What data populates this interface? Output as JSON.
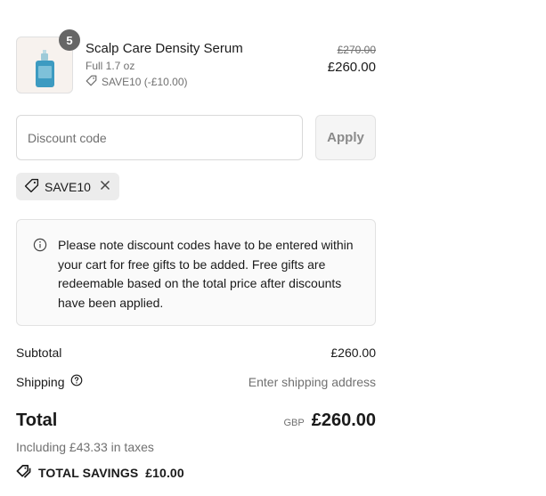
{
  "line_item": {
    "quantity": "5",
    "title": "Scalp Care Density Serum",
    "variant": "Full 1.7 oz",
    "discount": "SAVE10 (-£10.00)",
    "original_price": "£270.00",
    "price": "£260.00"
  },
  "discount_form": {
    "placeholder": "Discount code",
    "apply_label": "Apply"
  },
  "applied_code": "SAVE10",
  "notice": "Please note discount codes have to be entered within your cart for free gifts to be added. Free gifts are redeemable based on the total price after discounts have been applied.",
  "summary": {
    "subtotal_label": "Subtotal",
    "subtotal_value": "£260.00",
    "shipping_label": "Shipping",
    "shipping_value": "Enter shipping address",
    "total_label": "Total",
    "currency": "GBP",
    "total_value": "£260.00",
    "tax_note": "Including £43.33 in taxes",
    "savings_label": "TOTAL SAVINGS",
    "savings_value": "£10.00"
  },
  "icons": {
    "tag": "tag-icon",
    "info": "info-icon",
    "help": "question-circle-icon",
    "remove": "close-icon",
    "savings": "tags-icon"
  }
}
